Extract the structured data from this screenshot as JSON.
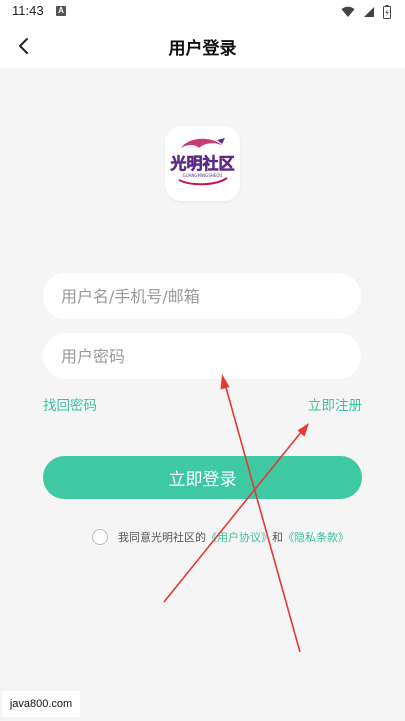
{
  "status_bar": {
    "time": "11:43",
    "notification_glyph": "A",
    "icons": [
      "wifi-icon",
      "signal-icon",
      "battery-icon"
    ]
  },
  "app_bar": {
    "title": "用户登录",
    "back_icon": "chevron-left-icon"
  },
  "logo": {
    "brand_text": "光明社区",
    "subtext": "GUANGMINGSHEQU"
  },
  "form": {
    "username_placeholder": "用户名/手机号/邮箱",
    "username_value": "",
    "password_placeholder": "用户密码",
    "password_value": "",
    "forgot_password_label": "找回密码",
    "register_label": "立即注册",
    "login_button_label": "立即登录"
  },
  "agreement": {
    "checked": false,
    "prefix": "我同意光明社区的",
    "user_agreement": "《用户协议》",
    "conjunction": "和",
    "privacy_policy": "《隐私条款》"
  },
  "watermark": {
    "text": "java800.com"
  },
  "colors": {
    "accent": "#3ec9a3",
    "link": "#3cc0a0",
    "background": "#f5f5f5",
    "annotation": "#e53935",
    "logo_magenta": "#d41f8c",
    "logo_purple": "#5b2a86"
  }
}
